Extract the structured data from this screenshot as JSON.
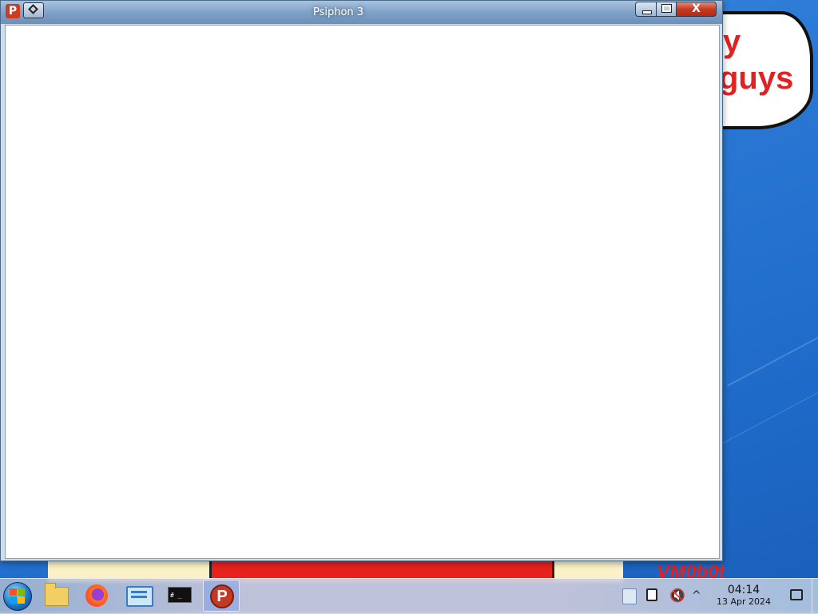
{
  "window": {
    "title": "Psiphon 3",
    "app_icon_letter": "P",
    "close_glyph": "X"
  },
  "wallpaper": {
    "bubble_line1": "y",
    "bubble_line2": "guys",
    "watermark": "VM0b0t"
  },
  "taskbar": {
    "pinned": [
      {
        "name": "file-explorer",
        "icon": "folder-icon"
      },
      {
        "name": "firefox",
        "icon": "firefox-icon"
      },
      {
        "name": "network-settings",
        "icon": "network-icon"
      },
      {
        "name": "terminal",
        "icon": "terminal-icon",
        "glyph": "# _"
      },
      {
        "name": "psiphon",
        "icon": "psiphon-icon",
        "glyph": "P",
        "active": true
      }
    ]
  },
  "tray": {
    "time": "04:14",
    "date": "13 Apr 2024",
    "volume_glyph": "🔇",
    "overflow_glyph": "^"
  },
  "colors": {
    "accent": "#2a78d4",
    "titlebar": "#7fa2c8",
    "close": "#c63a22",
    "psiphon": "#c23a24"
  }
}
